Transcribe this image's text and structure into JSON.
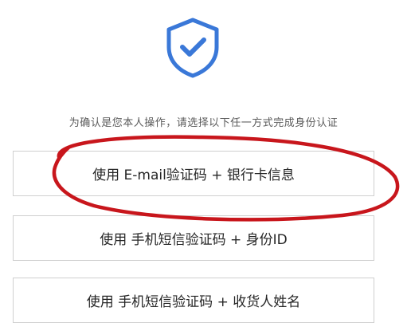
{
  "icon": {
    "name": "shield-check-icon",
    "color": "#3a78d8"
  },
  "prompt_text": "为确认是您本人操作，请选择以下任一方式完成身份认证",
  "options": [
    {
      "label": "使用 E-mail验证码 + 银行卡信息"
    },
    {
      "label": "使用 手机短信验证码 + 身份ID"
    },
    {
      "label": "使用 手机短信验证码 + 收货人姓名"
    }
  ],
  "annotation": {
    "color": "#c8161c"
  }
}
